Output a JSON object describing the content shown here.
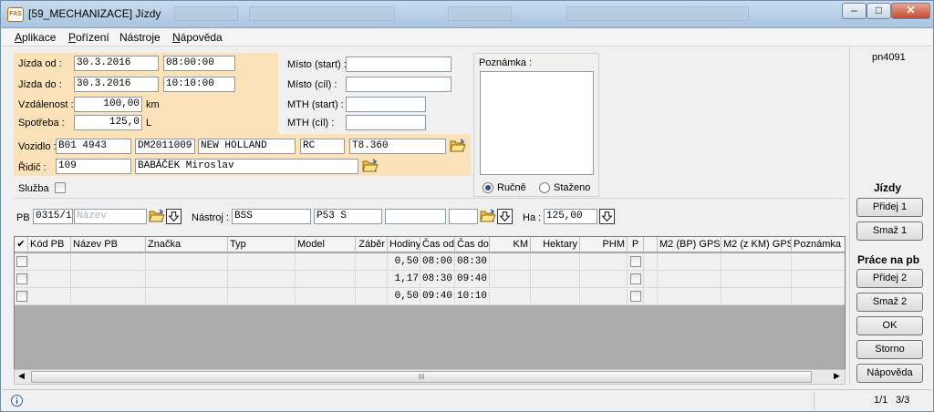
{
  "window": {
    "title": "[59_MECHANIZACE] Jízdy",
    "app_icon_text": "FAS",
    "controls": [
      "minimize-icon",
      "maximize-icon",
      "close-icon"
    ]
  },
  "menu": {
    "items": [
      {
        "label": "Aplikace",
        "key": "A"
      },
      {
        "label": "Pořízení",
        "key": "P"
      },
      {
        "label": "Nástroje",
        "key": "j"
      },
      {
        "label": "Nápověda",
        "key": "N"
      }
    ]
  },
  "form": {
    "jizda_od_label": "Jízda od :",
    "jizda_od_date": "30.3.2016",
    "jizda_od_time": "08:00:00",
    "jizda_do_label": "Jízda do :",
    "jizda_do_date": "30.3.2016",
    "jizda_do_time": "10:10:00",
    "vzdalenost_label": "Vzdálenost :",
    "vzdalenost_value": "100,00",
    "vzdalenost_unit": "km",
    "spotreba_label": "Spotřeba :",
    "spotreba_value": "125,0",
    "spotreba_unit": "L",
    "misto_start_label": "Místo (start) :",
    "misto_start_value": "",
    "misto_cil_label": "Místo (cíl) :",
    "misto_cil_value": "",
    "mth_start_label": "MTH (start) :",
    "mth_start_value": "",
    "mth_cil_label": "MTH (cíl) :",
    "mth_cil_value": "",
    "vozidlo_label": "Vozidlo :",
    "vozidlo_spz": "B01 4943",
    "vozidlo_kod": "DM2011009",
    "vozidlo_znacka": "NEW HOLLAND",
    "vozidlo_typ": "RC",
    "vozidlo_model": "T8.360",
    "ridic_label": "Řidič :",
    "ridic_cislo": "109",
    "ridic_jmeno": "BABÁČEK Miroslav",
    "sluzba_label": "Služba",
    "poznamka_label": "Poznámka :",
    "poznamka_value": "",
    "radio_rucne": "Ručně",
    "radio_stazeno": "Staženo",
    "radio_selected": "Ručně"
  },
  "pb_row": {
    "pb_label": "PB :",
    "pb_value": "0315/1",
    "pb_name_placeholder": "Název",
    "nastroj_label": "Nástroj :",
    "nastroj_value": "BSS",
    "nastroj_name": "P53 S",
    "nastroj_extra": "",
    "nastroj_extra2": "",
    "ha_label": "Ha :",
    "ha_value": "125,00"
  },
  "user_code": "pn4091",
  "grid": {
    "check_header": "✔",
    "headers": [
      "Kód PB",
      "Název PB",
      "Značka",
      "Typ",
      "Model",
      "Záběr",
      "Hodiny",
      "Čas od",
      "Čas do",
      "KM",
      "Hektary",
      "PHM",
      "P",
      "M2 (BP) GPS",
      "M2 (z KM) GPS",
      "Poznámka"
    ],
    "rows": [
      {
        "hodiny": "0,50",
        "cas_od": "08:00",
        "cas_do": "08:30"
      },
      {
        "hodiny": "1,17",
        "cas_od": "08:30",
        "cas_do": "09:40"
      },
      {
        "hodiny": "0,50",
        "cas_od": "09:40",
        "cas_do": "10:10"
      }
    ],
    "scroll_thumb": "III"
  },
  "side": {
    "jizdy_title": "Jízdy",
    "pridej1": "Přidej 1",
    "smaz1": "Smaž 1",
    "prace_title": "Práce na pb",
    "pridej2": "Přidej 2",
    "smaz2": "Smaž 2",
    "ok": "OK",
    "storno": "Storno",
    "napoveda": "Nápověda"
  },
  "status": {
    "info_icon": "info-icon",
    "record": "1/1",
    "count": "3/3"
  },
  "colors": {
    "orange_panel": "#fbe2b8",
    "grid_bg": "#ababab",
    "titlebar": "#b9cfe6"
  }
}
